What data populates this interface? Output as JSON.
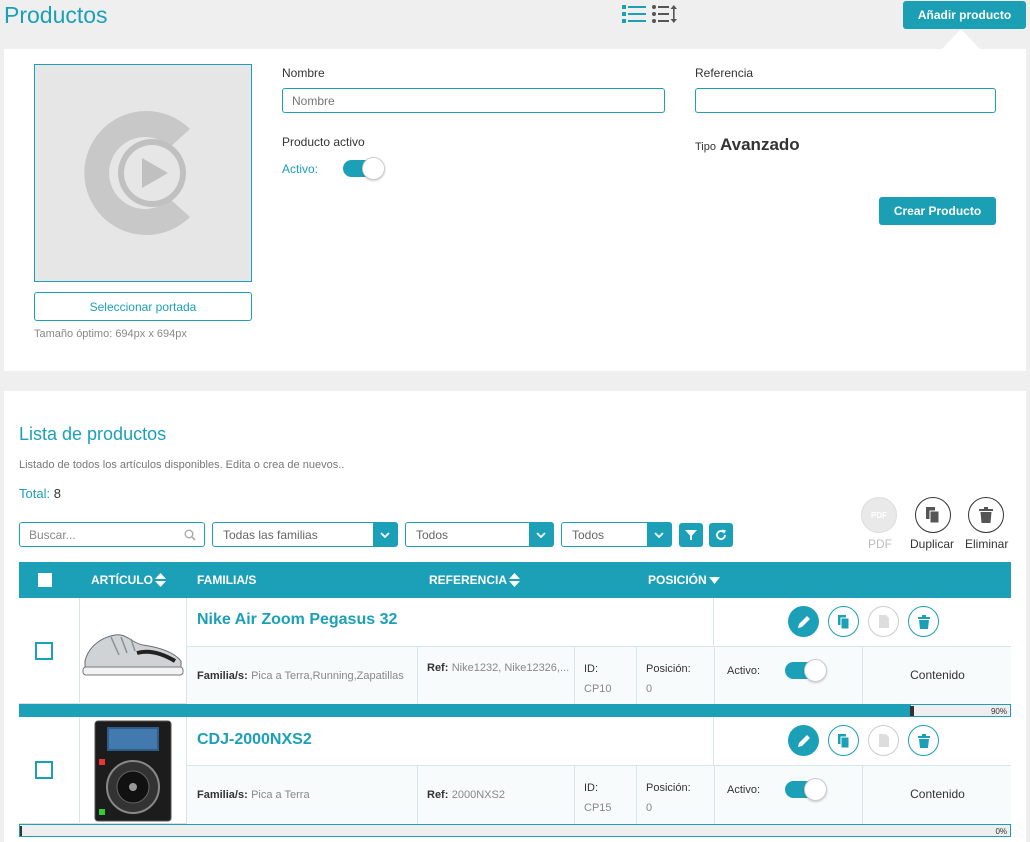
{
  "header": {
    "title": "Productos",
    "add_button": "Añadir producto"
  },
  "form": {
    "select_cover": "Seleccionar portada",
    "cover_hint": "Tamaño óptimo: 694px x 694px",
    "name_label": "Nombre",
    "name_placeholder": "Nombre",
    "name_value": "",
    "ref_label": "Referencia",
    "ref_value": "",
    "active_label": "Producto activo",
    "active_sub": "Activo:",
    "active_on": true,
    "tipo_label": "Tipo",
    "tipo_value": "Avanzado",
    "create_button": "Crear Producto"
  },
  "list": {
    "title": "Lista de productos",
    "subtitle": "Listado de todos los artículos disponibles. Edita o crea de nuevos..",
    "total_label": "Total:",
    "total_value": "8",
    "search_placeholder": "Buscar...",
    "filter_family": "Todas las familias",
    "filter_2": "Todos",
    "filter_3": "Todos",
    "actions": {
      "pdf": "PDF",
      "pdf_icon_text": "PDF",
      "duplicate": "Duplicar",
      "delete": "Eliminar"
    },
    "columns": {
      "articulo": "ARTÍCULO",
      "familia": "FAMILIA/S",
      "referencia": "REFERENCIA",
      "posicion": "POSICIÓN"
    },
    "rows": [
      {
        "name": "Nike Air Zoom Pegasus 32",
        "familia_label": "Familia/s:",
        "familia_value": "Pica a Terra,Running,Zapatillas",
        "ref_label": "Ref:",
        "ref_value": "Nike1232, Nike12326,...",
        "id_label": "ID:",
        "id_value": "CP10",
        "pos_label": "Posición:",
        "pos_value": "0",
        "active_label": "Activo:",
        "content": "Contenido",
        "progress": 90,
        "progress_text": "90%"
      },
      {
        "name": "CDJ-2000NXS2",
        "familia_label": "Familia/s:",
        "familia_value": "Pica a Terra",
        "ref_label": "Ref:",
        "ref_value": "2000NXS2",
        "id_label": "ID:",
        "id_value": "CP15",
        "pos_label": "Posición:",
        "pos_value": "0",
        "active_label": "Activo:",
        "content": "Contenido",
        "progress": 0,
        "progress_text": "0%"
      }
    ]
  },
  "colors": {
    "accent": "#1ba0b8",
    "progress_fill": "#1ba0b8",
    "progress_empty": "#eeeeee"
  }
}
